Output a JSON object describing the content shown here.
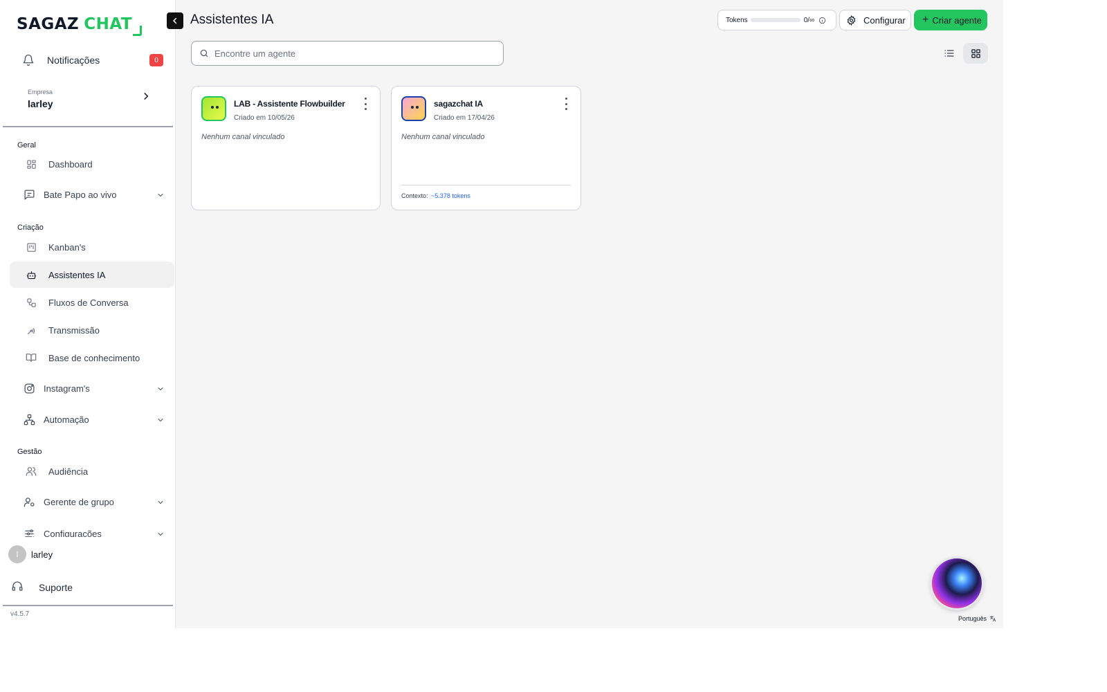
{
  "brand": {
    "part1": "SAGAZ",
    "part2": "CHAT",
    "accent": "#22c55e"
  },
  "sidebar": {
    "notifications": {
      "label": "Notificações",
      "count": "0"
    },
    "company": {
      "caption": "Empresa",
      "name": "larley"
    },
    "sections": {
      "geral": "Geral",
      "criacao": "Criação",
      "gestao": "Gestão"
    },
    "items": {
      "dashboard": "Dashboard",
      "bate_papo": "Bate Papo ao vivo",
      "kanbans": "Kanban's",
      "assistentes": "Assistentes IA",
      "fluxos": "Fluxos de Conversa",
      "transmissao": "Transmissão",
      "base": "Base de conhecimento",
      "instagram": "Instagram's",
      "automacao": "Automação",
      "audiencia": "Audiência",
      "gerente": "Gerente de grupo",
      "configuracoes": "Configurações"
    },
    "user": {
      "initial": "l",
      "name": "larley"
    },
    "support": "Suporte",
    "version": "v4.5.7"
  },
  "header": {
    "title": "Assistentes IA",
    "tokens": {
      "label": "Tokens",
      "value": "0/∞",
      "progress": 0
    },
    "config_label": "Configurar",
    "create_label": "Criar agente"
  },
  "search": {
    "placeholder": "Encontre um agente",
    "value": ""
  },
  "agents": [
    {
      "name": "LAB - Assistente Flowbuilder",
      "created": "Criado em 10/05/26",
      "channels": "Nenhum canal vinculado",
      "avatar_color": "#a3e635"
    },
    {
      "name": "sagazchat IA",
      "created": "Criado em 17/04/26",
      "channels": "Nenhum canal vinculado",
      "avatar_color": "#fbbf24",
      "context_label": "Contexto:",
      "context_value": "~5.378 tokens"
    }
  ],
  "language": "Português"
}
